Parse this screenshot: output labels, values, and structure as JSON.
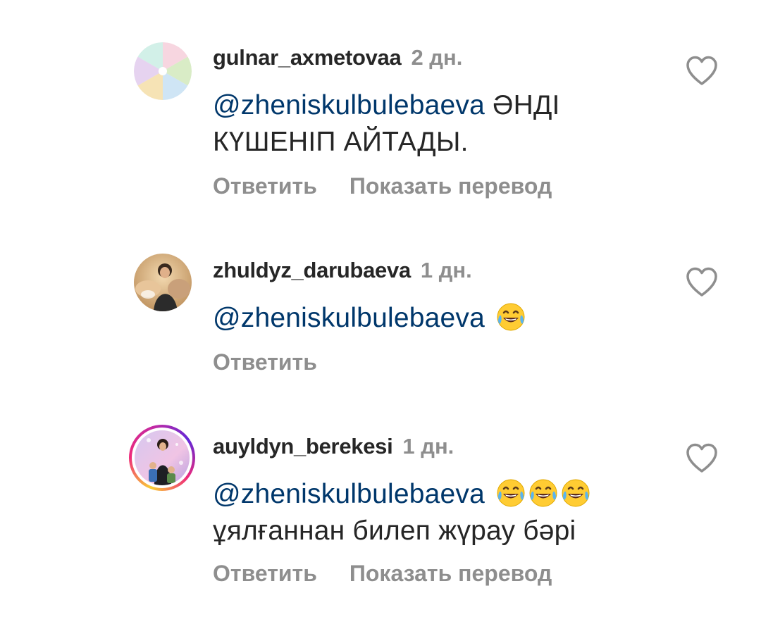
{
  "comments": [
    {
      "username": "gulnar_axmetovaa",
      "time": "2 дн.",
      "mention": "@zheniskulbulebaeva",
      "text_inline": "ӘНДІ",
      "text_line2": "КҮШЕНІП АЙТАДЫ.",
      "reply_label": "Ответить",
      "translate_label": "Показать перевод",
      "like_icon": "heart-outline-icon",
      "avatar_desc": "pie-wheel-avatar"
    },
    {
      "username": "zhuldyz_darubaeva",
      "time": "1 дн.",
      "mention": "@zheniskulbulebaeva",
      "emoji_count": 1,
      "reply_label": "Ответить",
      "like_icon": "heart-outline-icon",
      "avatar_desc": "photo-avatar"
    },
    {
      "username": "auyldyn_berekesi",
      "time": "1 дн.",
      "mention": "@zheniskulbulebaeva",
      "emoji_count": 3,
      "text_line2": "ұялғаннан билеп жүрау бәрі",
      "reply_label": "Ответить",
      "translate_label": "Показать перевод",
      "like_icon": "heart-outline-icon",
      "avatar_desc": "story-ring-photo-avatar"
    }
  ],
  "colors": {
    "text": "#262626",
    "secondary": "#8e8e8e",
    "mention": "#00376b",
    "background": "#ffffff"
  }
}
